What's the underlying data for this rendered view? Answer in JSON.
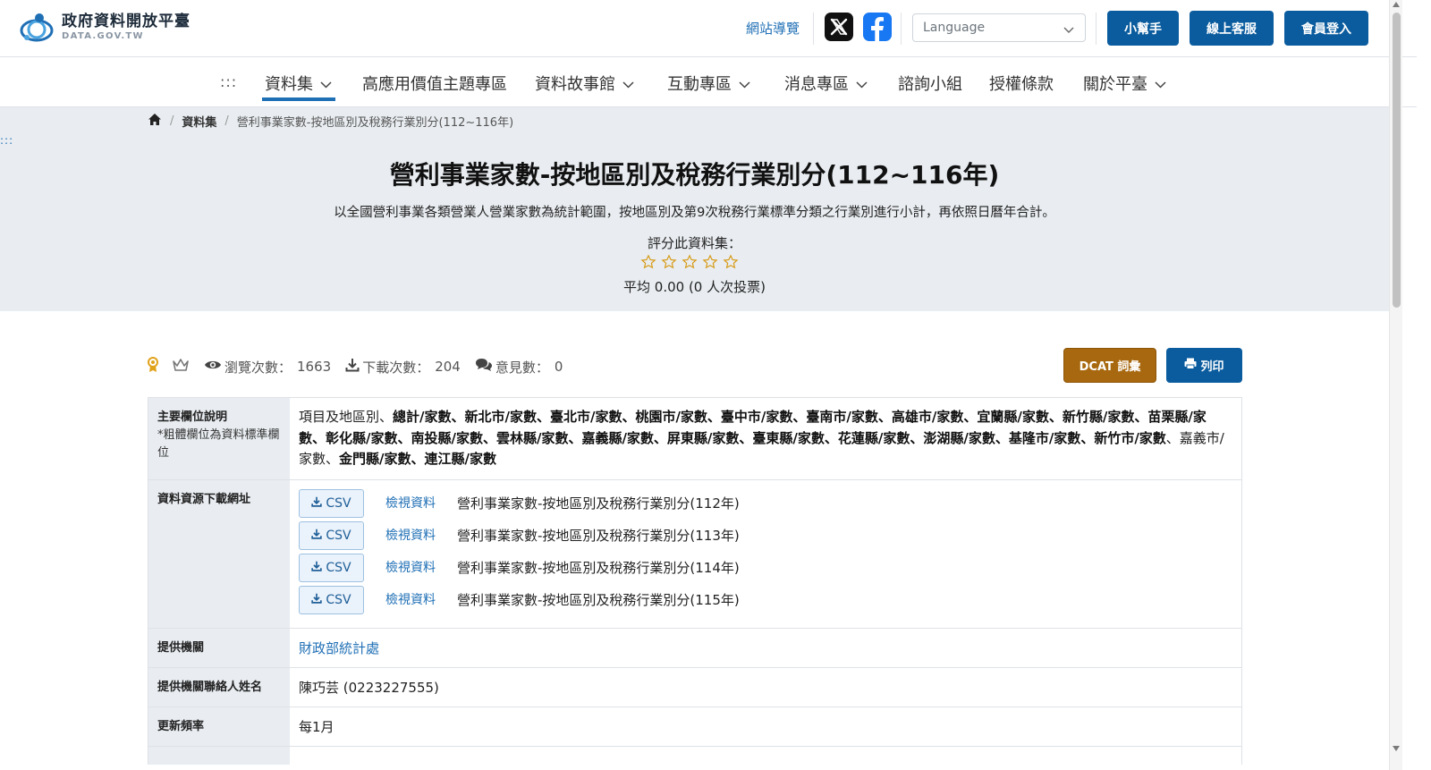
{
  "header": {
    "logo_cn": "政府資料開放平臺",
    "logo_en": "DATA.GOV.TW",
    "sitemap": "網站導覽",
    "language_placeholder": "Language",
    "buttons": {
      "helper": "小幫手",
      "service": "線上客服",
      "login": "會員登入"
    }
  },
  "nav": {
    "dots": ":::",
    "items": [
      {
        "label": "資料集",
        "dropdown": true,
        "active": true
      },
      {
        "label": "高應用價值主題專區",
        "dropdown": false
      },
      {
        "label": "資料故事館",
        "dropdown": true
      },
      {
        "label": "互動專區",
        "dropdown": true
      },
      {
        "label": "消息專區",
        "dropdown": true
      },
      {
        "label": "諮詢小組",
        "dropdown": false
      },
      {
        "label": "授權條款",
        "dropdown": false
      },
      {
        "label": "關於平臺",
        "dropdown": true
      }
    ]
  },
  "hero": {
    "dots": ":::",
    "breadcrumb": {
      "home": "home-icon",
      "level1": "資料集",
      "current": "營利事業家數-按地區別及稅務行業別分(112~116年)"
    },
    "title": "營利事業家數-按地區別及稅務行業別分(112~116年)",
    "description": "以全國營利事業各類營業人營業家數為統計範圍，按地區別及第9次稅務行業標準分類之行業別進行小計，再依照日曆年合計。",
    "rate_label": "評分此資料集：",
    "stars": 5,
    "average": "平均 0.00 (0 人次投票)"
  },
  "stats": {
    "views_label": "瀏覽次數：",
    "views": "1663",
    "downloads_label": "下載次數：",
    "downloads": "204",
    "comments_label": "意見數：",
    "comments": "0",
    "dcat_button": "DCAT 詞彙",
    "print_button": "列印"
  },
  "info": {
    "fields_header": "主要欄位說明",
    "fields_note": "*粗體欄位為資料標準欄位",
    "fields_text": {
      "p1": "項目及地區別、",
      "b1": "總計/家數、新北市/家數、臺北市/家數、桃園市/家數、臺中市/家數、臺南市/家數、高雄市/家數、宜蘭縣/家數、新竹縣/家數、苗栗縣/家數、彰化縣/家數、南投縣/家數、雲林縣/家數、嘉義縣/家數、屏東縣/家數、臺東縣/家數、花蓮縣/家數、澎湖縣/家數、基隆市/家數、新竹市/家數",
      "p2": "、嘉義市/家數、",
      "b2": "金門縣/家數、連江縣/家數"
    },
    "download_header": "資料資源下載網址",
    "csv_label": "CSV",
    "view_label": "檢視資料",
    "resources": [
      "營利事業家數-按地區別及稅務行業別分(112年)",
      "營利事業家數-按地區別及稅務行業別分(113年)",
      "營利事業家數-按地區別及稅務行業別分(114年)",
      "營利事業家數-按地區別及稅務行業別分(115年)"
    ],
    "agency_header": "提供機關",
    "agency": "財政部統計處",
    "contact_header": "提供機關聯絡人姓名",
    "contact": "陳巧芸 (0223227555)",
    "frequency_header": "更新頻率",
    "frequency": "每1月"
  }
}
